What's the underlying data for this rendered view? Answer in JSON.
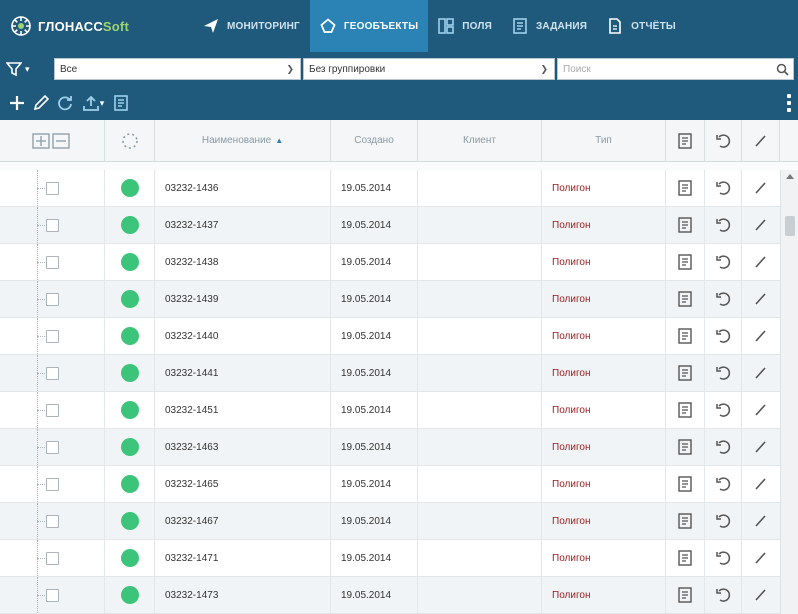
{
  "app": {
    "logo_main": "ГЛОНАСС",
    "logo_soft": "Soft"
  },
  "nav": [
    {
      "label": "МОНИТОРИНГ",
      "icon": "paper-plane-icon",
      "active": false
    },
    {
      "label": "ГЕООБЪЕКТЫ",
      "icon": "polygon-icon",
      "active": true
    },
    {
      "label": "ПОЛЯ",
      "icon": "grid-icon",
      "active": false
    },
    {
      "label": "ЗАДАНИЯ",
      "icon": "task-icon",
      "active": false
    },
    {
      "label": "ОТЧЁТЫ",
      "icon": "document-icon",
      "active": false
    }
  ],
  "filters": {
    "filter_value": "Все",
    "grouping_value": "Без группировки",
    "search_placeholder": "Поиск"
  },
  "table": {
    "columns": [
      "Наименование",
      "Создано",
      "Клиент",
      "Тип"
    ],
    "sort_indicator": "▲",
    "rows": [
      {
        "name": "03232-1436",
        "created": "19.05.2014",
        "client": "",
        "type": "Полигон"
      },
      {
        "name": "03232-1437",
        "created": "19.05.2014",
        "client": "",
        "type": "Полигон"
      },
      {
        "name": "03232-1438",
        "created": "19.05.2014",
        "client": "",
        "type": "Полигон"
      },
      {
        "name": "03232-1439",
        "created": "19.05.2014",
        "client": "",
        "type": "Полигон"
      },
      {
        "name": "03232-1440",
        "created": "19.05.2014",
        "client": "",
        "type": "Полигон"
      },
      {
        "name": "03232-1441",
        "created": "19.05.2014",
        "client": "",
        "type": "Полигон"
      },
      {
        "name": "03232-1451",
        "created": "19.05.2014",
        "client": "",
        "type": "Полигон"
      },
      {
        "name": "03232-1463",
        "created": "19.05.2014",
        "client": "",
        "type": "Полигон"
      },
      {
        "name": "03232-1465",
        "created": "19.05.2014",
        "client": "",
        "type": "Полигон"
      },
      {
        "name": "03232-1467",
        "created": "19.05.2014",
        "client": "",
        "type": "Полигон"
      },
      {
        "name": "03232-1471",
        "created": "19.05.2014",
        "client": "",
        "type": "Полигон"
      },
      {
        "name": "03232-1473",
        "created": "19.05.2014",
        "client": "",
        "type": "Полигон"
      }
    ]
  },
  "colors": {
    "header_bg": "#1f5a7d",
    "active_tab": "#2a82b5",
    "status_green": "#3cc47a",
    "type_text": "#9b1b1b"
  }
}
